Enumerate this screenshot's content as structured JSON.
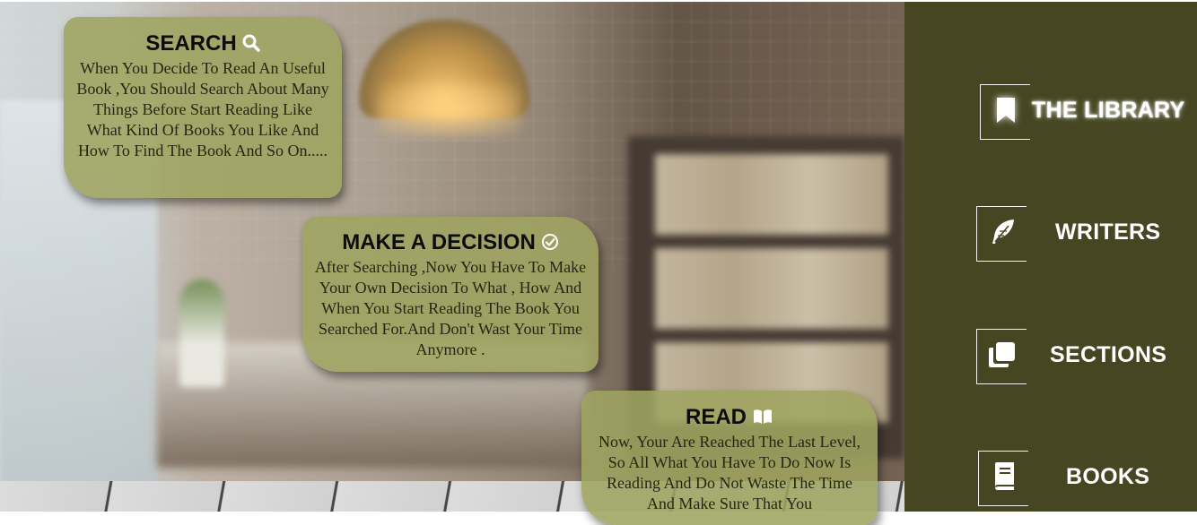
{
  "cards": {
    "search": {
      "title": "SEARCH",
      "icon": "search-icon",
      "text": "When You Decide To Read An Useful Book ,You Should Search About Many Things Before Start Reading Like What Kind Of Books You Like And How To Find The Book And So On....."
    },
    "decision": {
      "title": "MAKE A DECISION",
      "icon": "check-circle-icon",
      "text": "After Searching ,Now You Have To Make Your Own Decision To What , How And When You Start Reading The Book You Searched For.And Don't Wast Your Time Anymore ."
    },
    "read": {
      "title": "READ",
      "icon": "open-book-icon",
      "text": "Now, Your Are Reached The Last Level, So All What You Have To Do Now Is Reading And Do Not Waste The Time And Make Sure That You"
    }
  },
  "sidebar": {
    "items": [
      {
        "label": "THE LIBRARY",
        "icon": "bookmark-icon"
      },
      {
        "label": "WRITERS",
        "icon": "feather-icon"
      },
      {
        "label": "SECTIONS",
        "icon": "copy-icon"
      },
      {
        "label": "BOOKS",
        "icon": "book-icon"
      }
    ]
  },
  "colors": {
    "sidebar_bg": "#464722",
    "card_bg": "#9ea460",
    "nav_text": "#ffffff"
  }
}
